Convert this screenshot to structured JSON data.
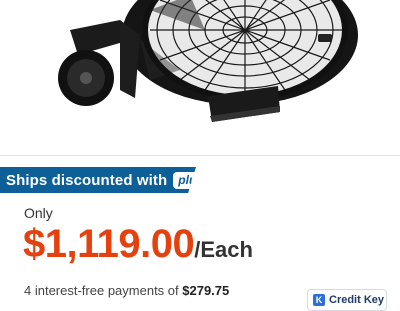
{
  "product": {
    "image_icon": "drum-fan-image"
  },
  "shipping": {
    "label": "Ships discounted with",
    "badge": "plus"
  },
  "pricing": {
    "prefix": "Only",
    "price": "$1,119.00",
    "unit": "/Each"
  },
  "financing": {
    "text_before": "4 interest-free payments of ",
    "amount": "$279.75",
    "provider": "Credit Key"
  },
  "colors": {
    "banner": "#0d5f98",
    "price": "#e5410f"
  }
}
